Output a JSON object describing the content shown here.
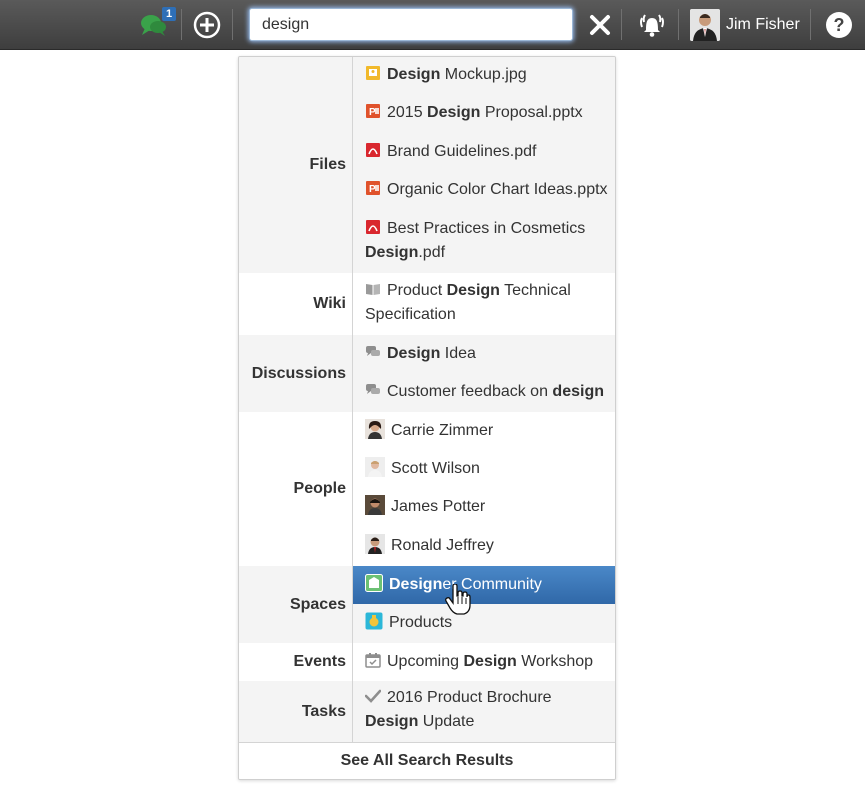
{
  "topbar": {
    "chat_badge": "1",
    "search_value": "design",
    "user_name": "Jim Fisher",
    "help_label": "?"
  },
  "results": {
    "files": {
      "label": "Files",
      "items": [
        {
          "bold_pre": "Design",
          "text": " Mockup.jpg",
          "icon": "image-file-icon"
        },
        {
          "pre": "2015 ",
          "bold": "Design",
          "post": " Proposal.pptx",
          "icon": "powerpoint-file-icon"
        },
        {
          "text": "Brand Guidelines.pdf",
          "icon": "pdf-file-icon"
        },
        {
          "text": "Organic Color Chart Ideas.pptx",
          "icon": "powerpoint-file-icon"
        },
        {
          "pre": "Best Practices in Cosmetics ",
          "bold": "Design",
          "post": ".pdf",
          "icon": "pdf-file-icon"
        }
      ]
    },
    "wiki": {
      "label": "Wiki",
      "items": [
        {
          "pre": "Product ",
          "bold": "Design",
          "post": " Technical Specification",
          "icon": "book-icon"
        }
      ]
    },
    "discussions": {
      "label": "Discussions",
      "items": [
        {
          "bold_pre": "Design",
          "text": " Idea",
          "icon": "discussion-icon"
        },
        {
          "pre": "Customer feedback on ",
          "bold": "design",
          "post": "",
          "icon": "discussion-icon"
        }
      ]
    },
    "people": {
      "label": "People",
      "items": [
        {
          "text": "Carrie Zimmer",
          "icon": "person-avatar-icon"
        },
        {
          "text": "Scott Wilson",
          "icon": "person-avatar-icon"
        },
        {
          "text": "James Potter",
          "icon": "person-avatar-icon"
        },
        {
          "text": "Ronald Jeffrey",
          "icon": "person-avatar-icon"
        }
      ]
    },
    "spaces": {
      "label": "Spaces",
      "items": [
        {
          "bold_pre": "Design",
          "text": "er Community",
          "icon": "space-icon"
        },
        {
          "text": "Products",
          "icon": "space-icon"
        }
      ]
    },
    "events": {
      "label": "Events",
      "items": [
        {
          "pre": "Upcoming ",
          "bold": "Design",
          "post": " Workshop",
          "icon": "calendar-icon"
        }
      ]
    },
    "tasks": {
      "label": "Tasks",
      "items": [
        {
          "pre": "2016 Product Brochure ",
          "bold": "Design",
          "post": " Update",
          "icon": "checkmark-icon"
        }
      ]
    },
    "see_all": "See All Search Results"
  },
  "colors": {
    "topbar": "#4a4a4a",
    "highlight": "#3a78b8",
    "chat_icon": "#3aa24a",
    "badge": "#2e6fb7"
  }
}
